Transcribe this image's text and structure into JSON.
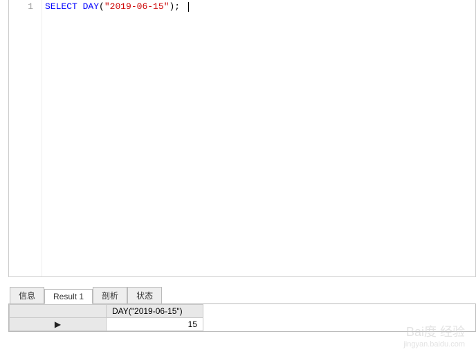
{
  "editor": {
    "line_number": "1",
    "keyword_select": "SELECT",
    "func_day": "DAY",
    "paren_open": "(",
    "string_lit": "\"2019-06-15\"",
    "paren_close": ")",
    "semicolon": ";"
  },
  "tabs": {
    "info": "信息",
    "result1": "Result 1",
    "analysis": "剖析",
    "status": "状态"
  },
  "result": {
    "header": "DAY(\"2019-06-15\")",
    "row_marker": "▶",
    "value": "15"
  },
  "watermark": {
    "main": "Bai度 经验",
    "sub": "jingyan.baidu.com"
  }
}
